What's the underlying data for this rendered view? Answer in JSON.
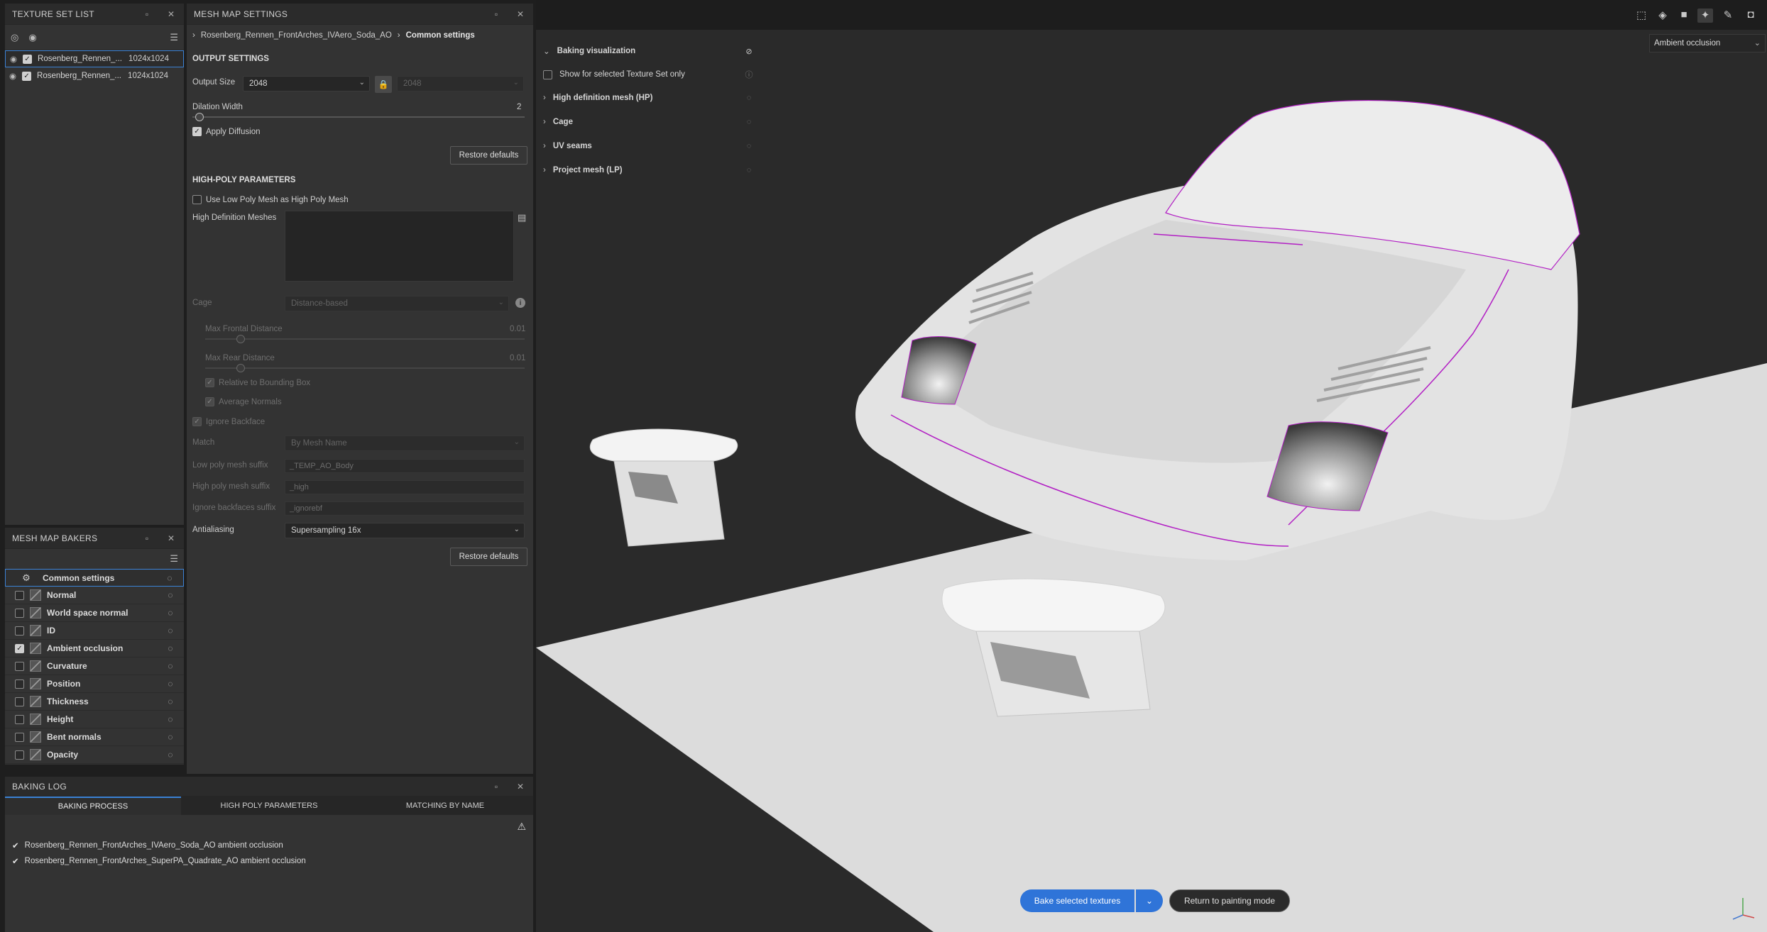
{
  "texture_set_list": {
    "title": "TEXTURE SET LIST",
    "items": [
      {
        "name": "Rosenberg_Rennen_...",
        "size": "1024x1024"
      },
      {
        "name": "Rosenberg_Rennen_...",
        "size": "1024x1024"
      }
    ]
  },
  "mesh_map_bakers": {
    "title": "MESH MAP BAKERS",
    "common": "Common settings",
    "bakers": [
      {
        "label": "Normal",
        "checked": false
      },
      {
        "label": "World space normal",
        "checked": false
      },
      {
        "label": "ID",
        "checked": false
      },
      {
        "label": "Ambient occlusion",
        "checked": true
      },
      {
        "label": "Curvature",
        "checked": false
      },
      {
        "label": "Position",
        "checked": false
      },
      {
        "label": "Thickness",
        "checked": false
      },
      {
        "label": "Height",
        "checked": false
      },
      {
        "label": "Bent normals",
        "checked": false
      },
      {
        "label": "Opacity",
        "checked": false
      }
    ]
  },
  "mesh_map_settings": {
    "title": "MESH MAP SETTINGS",
    "breadcrumb": [
      "Rosenberg_Rennen_FrontArches_IVAero_Soda_AO",
      "Common settings"
    ],
    "output": {
      "section": "OUTPUT SETTINGS",
      "size_label": "Output Size",
      "size_value": "2048",
      "size_value_locked": "2048",
      "dilation_label": "Dilation Width",
      "dilation_value": "2",
      "apply_diffusion": "Apply Diffusion",
      "restore": "Restore defaults"
    },
    "high_poly": {
      "section": "HIGH-POLY PARAMETERS",
      "use_low_poly": "Use Low Poly Mesh as High Poly Mesh",
      "hd_meshes": "High Definition Meshes",
      "cage_label": "Cage",
      "cage_value": "Distance-based",
      "max_frontal": "Max Frontal Distance",
      "max_frontal_value": "0.01",
      "max_rear": "Max Rear Distance",
      "max_rear_value": "0.01",
      "relative_bbox": "Relative to Bounding Box",
      "average_normals": "Average Normals",
      "ignore_backface": "Ignore Backface",
      "match_label": "Match",
      "match_value": "By Mesh Name",
      "low_suffix_label": "Low poly mesh suffix",
      "low_suffix_value": "_TEMP_AO_Body",
      "high_suffix_label": "High poly mesh suffix",
      "high_suffix_value": "_high",
      "ignore_suffix_label": "Ignore backfaces suffix",
      "ignore_suffix_value": "_ignorebf",
      "aa_label": "Antialiasing",
      "aa_value": "Supersampling 16x",
      "restore": "Restore defaults"
    }
  },
  "baking_log": {
    "title": "BAKING LOG",
    "tabs": [
      "BAKING PROCESS",
      "HIGH POLY PARAMETERS",
      "MATCHING BY NAME"
    ],
    "lines": [
      "Rosenberg_Rennen_FrontArches_IVAero_Soda_AO ambient occlusion",
      "Rosenberg_Rennen_FrontArches_SuperPA_Quadrate_AO ambient occlusion"
    ]
  },
  "viewport": {
    "display_mode": "Ambient occlusion",
    "visualization": {
      "title": "Baking visualization",
      "show_selected": "Show for selected Texture Set only",
      "groups": [
        "High definition mesh (HP)",
        "Cage",
        "UV seams",
        "Project mesh (LP)"
      ]
    },
    "bake_button": "Bake selected textures",
    "return_button": "Return to painting mode"
  },
  "colors": {
    "accent": "#2f74d8",
    "selection": "#3b82d6",
    "seams": "#b21fc4"
  }
}
